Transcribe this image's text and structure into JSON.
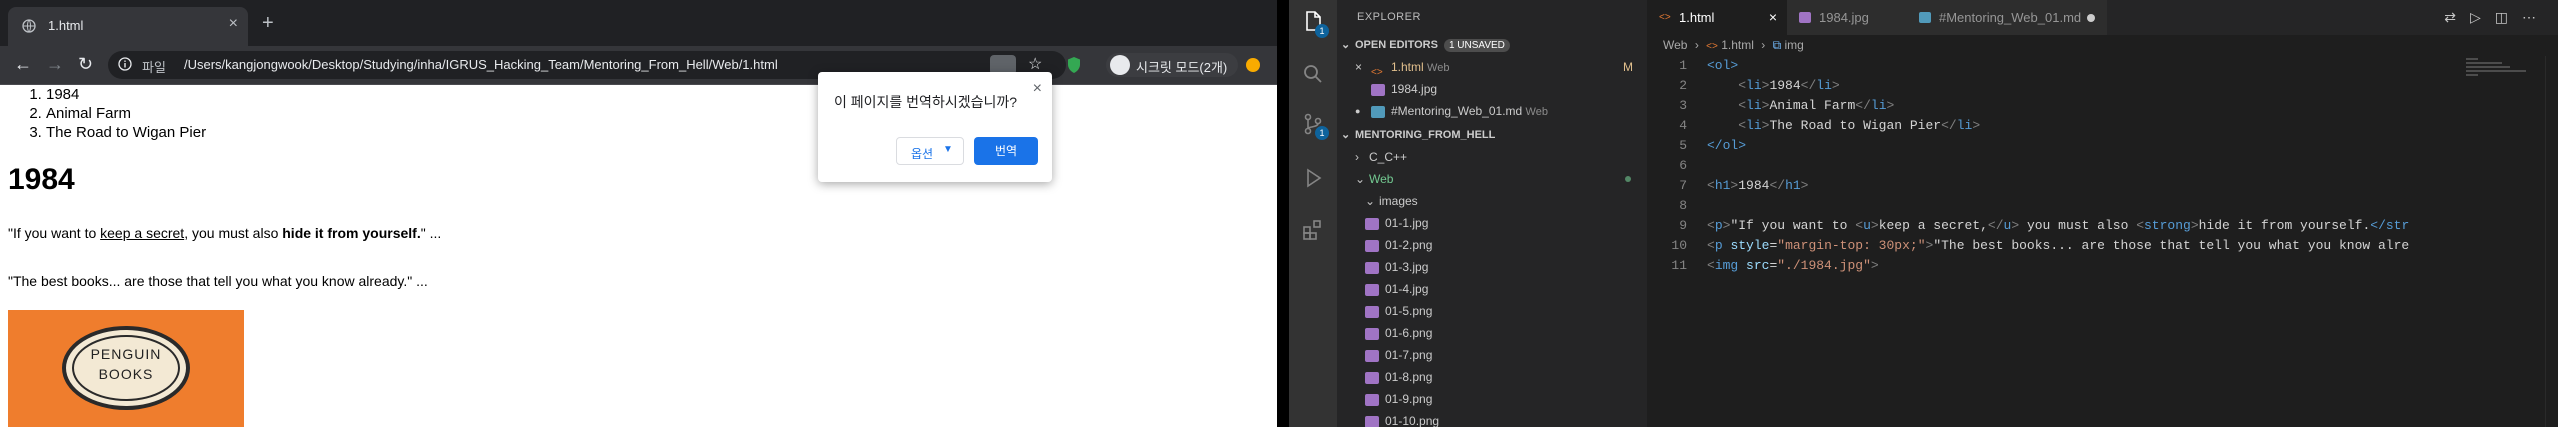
{
  "browser": {
    "tab_title": "1.html",
    "tab_close": "×",
    "new_tab": "+",
    "nav": {
      "back": "←",
      "forward": "→",
      "reload": "↻"
    },
    "scheme_label": "파일",
    "url": "/Users/kangjongwook/Desktop/Studying/inha/IGRUS_Hacking_Team/Mentoring_From_Hell/Web/1.html",
    "bookmark_star": "☆",
    "incognito_label": "시크릿 모드(2개)",
    "translate_popup": {
      "question": "이 페이지를 번역하시겠습니까?",
      "options_label": "옵션",
      "translate_label": "번역",
      "close": "×"
    },
    "page": {
      "list": [
        "1984",
        "Animal Farm",
        "The Road to Wigan Pier"
      ],
      "heading": "1984",
      "quote1_prefix": "\"If you want to ",
      "quote1_underline": "keep a secret",
      "quote1_mid": ", you must also ",
      "quote1_bold": "hide it from yourself.",
      "quote1_suffix": "\" ...",
      "quote2": "\"The best books... are those that tell you what you know already.\" ...",
      "book_line1": "PENGUIN",
      "book_line2": "BOOKS"
    }
  },
  "vscode": {
    "explorer_title": "EXPLORER",
    "open_editors": {
      "label": "OPEN EDITORS",
      "badge": "1 UNSAVED",
      "items": [
        {
          "prefix": "×",
          "name": "1.html",
          "folder": "Web",
          "status": "M"
        },
        {
          "prefix": "",
          "name": "1984.jpg",
          "folder": "",
          "status": ""
        },
        {
          "prefix": "●",
          "name": "#Mentoring_Web_01.md",
          "folder": "Web",
          "status": ""
        }
      ]
    },
    "workspace": {
      "label": "MENTORING_FROM_HELL",
      "folders": [
        "C_C++",
        "Web",
        "images"
      ],
      "files": [
        "01-1.jpg",
        "01-2.png",
        "01-3.jpg",
        "01-4.jpg",
        "01-5.png",
        "01-6.png",
        "01-7.png",
        "01-8.png",
        "01-9.png",
        "01-10.png"
      ]
    },
    "tabs": [
      {
        "name": "1.html",
        "close": "×"
      },
      {
        "name": "1984.jpg"
      },
      {
        "name": "#Mentoring_Web_01.md"
      }
    ],
    "breadcrumb": {
      "folder": "Web",
      "file": "1.html",
      "symbol": "img"
    },
    "line_numbers": [
      "1",
      "2",
      "3",
      "4",
      "5",
      "6",
      "7",
      "8",
      "9",
      "10",
      "11"
    ],
    "code": {
      "l1_open": "<ol>",
      "l2_text": "1984",
      "l3_text": "Animal Farm",
      "l4_text": "The Road to Wigan Pier",
      "l5_close": "</ol>",
      "l7_text": "1984",
      "l9_text1": "\"If you want to ",
      "l9_text2": "keep a secret,",
      "l9_text3": " you must also ",
      "l9_text4": "hide it from yourself.",
      "l9_tail": "</str",
      "l10_style": "\"margin-top: 30px;\"",
      "l10_text": "\"The best books... are those that tell you what you know alre",
      "l11_src": "\"./1984.jpg\""
    }
  }
}
